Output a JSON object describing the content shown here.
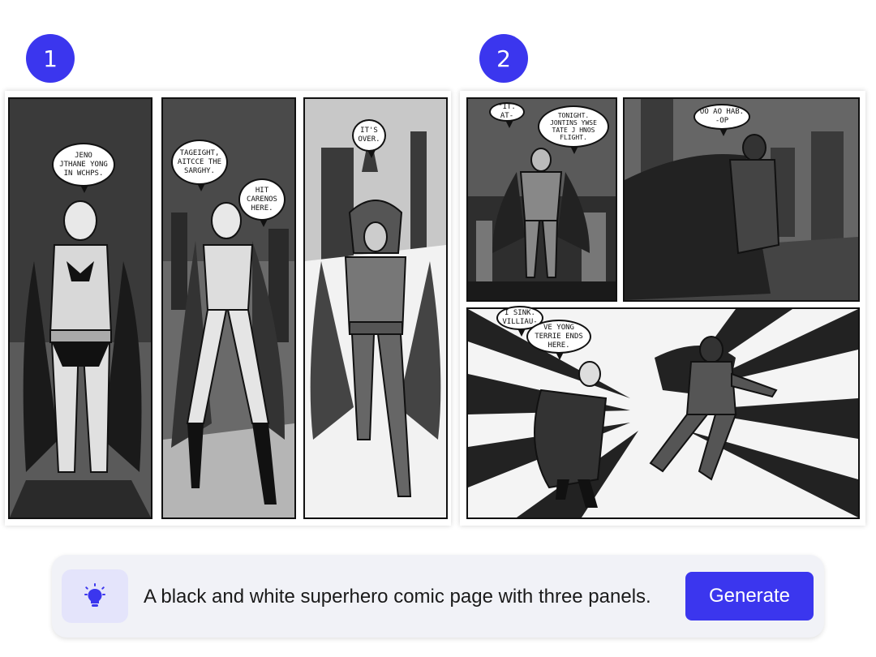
{
  "badges": [
    "1",
    "2"
  ],
  "comic_1": {
    "bubbles": [
      "JENO\nJTHANE YONG\nIN WCHPS.",
      "TAGEIGHT,\nAITCCE THE\nSARGHY.",
      "HIT\nCARENOS\nHERE.",
      "IT'S\nOVER."
    ]
  },
  "comic_2": {
    "bubbles": [
      "\"IT. AT-",
      "TONIGHT.\nJONTINS YWSE\nTATE J HNOS\nFLIGHT.",
      "OO AO HAB.\n-OP",
      "I SINK.\nVILLIAU-",
      "VE YONG\nTERRIE ENDS\nHERE."
    ]
  },
  "prompt": {
    "icon": "lightbulb-icon",
    "text": "A black and white superhero comic page with three panels.",
    "button_label": "Generate"
  },
  "colors": {
    "accent": "#3b36ee",
    "prompt_bg": "#f1f2f7",
    "icon_bg": "#e4e4fb"
  }
}
